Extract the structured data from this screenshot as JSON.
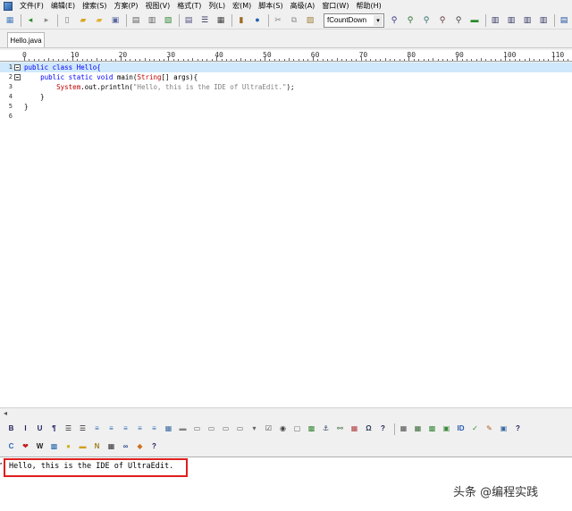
{
  "menu": [
    "文件(F)",
    "编辑(E)",
    "搜索(S)",
    "方案(P)",
    "视图(V)",
    "格式(T)",
    "列(L)",
    "宏(M)",
    "脚本(S)",
    "高级(A)",
    "窗口(W)",
    "帮助(H)"
  ],
  "toolbar": {
    "function_list_value": "fCountDown",
    "icons": [
      {
        "name": "new-file-icon",
        "glyph": "▦",
        "color": "#4a7fc0"
      },
      {
        "name": "back-icon",
        "glyph": "◂",
        "color": "#2a8a2a"
      },
      {
        "name": "forward-icon",
        "glyph": "▸",
        "color": "#8a8a8a"
      },
      {
        "name": "blank-doc-icon",
        "glyph": "▯",
        "color": "#7a7a7a"
      },
      {
        "name": "open-folder-icon",
        "glyph": "▰",
        "color": "#d9a520"
      },
      {
        "name": "open-project-icon",
        "glyph": "▰",
        "color": "#e0b030"
      },
      {
        "name": "save-icon",
        "glyph": "▣",
        "color": "#5a6aa0"
      },
      {
        "name": "print-icon",
        "glyph": "▤",
        "color": "#606060"
      },
      {
        "name": "print-preview-icon",
        "glyph": "▥",
        "color": "#606060"
      },
      {
        "name": "export-icon",
        "glyph": "▧",
        "color": "#3a8a3a"
      },
      {
        "name": "document-icon",
        "glyph": "▤",
        "color": "#505080"
      },
      {
        "name": "list-icon",
        "glyph": "☰",
        "color": "#303060"
      },
      {
        "name": "hex-icon",
        "glyph": "▦",
        "color": "#404040"
      },
      {
        "name": "book-icon",
        "glyph": "▮",
        "color": "#a06a20"
      },
      {
        "name": "globe-icon",
        "glyph": "●",
        "color": "#2060b0"
      },
      {
        "name": "cut-icon",
        "glyph": "✂",
        "color": "#808080"
      },
      {
        "name": "copy-icon",
        "glyph": "⧉",
        "color": "#909090"
      },
      {
        "name": "paste-icon",
        "glyph": "▨",
        "color": "#a08040"
      }
    ],
    "right_icons": [
      {
        "name": "find-icon",
        "glyph": "⚲",
        "color": "#303080"
      },
      {
        "name": "find-next-icon",
        "glyph": "⚲",
        "color": "#2a6a2a"
      },
      {
        "name": "replace-icon",
        "glyph": "⚲",
        "color": "#2a6a6a"
      },
      {
        "name": "find-in-files-icon",
        "glyph": "⚲",
        "color": "#603030"
      },
      {
        "name": "replace-in-files-icon",
        "glyph": "⚲",
        "color": "#404040"
      },
      {
        "name": "goto-icon",
        "glyph": "▬",
        "color": "#2a8a2a"
      },
      {
        "name": "align-left-icon",
        "glyph": "▥",
        "color": "#303060"
      },
      {
        "name": "align-center-icon",
        "glyph": "▥",
        "color": "#303060"
      },
      {
        "name": "align-right-icon",
        "glyph": "▥",
        "color": "#303060"
      },
      {
        "name": "justify-icon",
        "glyph": "▥",
        "color": "#303060"
      },
      {
        "name": "split-h-icon",
        "glyph": "▤",
        "color": "#1f4fa0"
      },
      {
        "name": "split-v-icon",
        "glyph": "▥",
        "color": "#1f4fa0"
      },
      {
        "name": "tile-icon",
        "glyph": "▧",
        "color": "#1f4fa0"
      },
      {
        "name": "window-icon",
        "glyph": "▢",
        "color": "#404040"
      },
      {
        "name": "web-icon",
        "glyph": "●",
        "color": "#2a7ac0"
      },
      {
        "name": "help-icon",
        "glyph": "?",
        "color": "#2050a0"
      }
    ]
  },
  "tab": {
    "filename": "Hello.java"
  },
  "ruler": [
    "0",
    "10",
    "20",
    "30",
    "40",
    "50",
    "60",
    "70",
    "80",
    "90",
    "100",
    "110"
  ],
  "code_lines": [
    {
      "num": "1",
      "fold": true,
      "current": true,
      "tokens": [
        [
          "kw",
          "public class Hello{"
        ]
      ]
    },
    {
      "num": "2",
      "fold": true,
      "current": false,
      "tokens": [
        [
          "tx",
          "    "
        ],
        [
          "kw",
          "public static void"
        ],
        [
          "tx",
          " main("
        ],
        [
          "ty",
          "String"
        ],
        [
          "tx",
          "[] args){"
        ]
      ]
    },
    {
      "num": "3",
      "fold": false,
      "current": false,
      "tokens": [
        [
          "tx",
          "        "
        ],
        [
          "sy",
          "System"
        ],
        [
          "tx",
          ".out.println("
        ],
        [
          "st",
          "\"Hello, this is the IDE of UltraEdit.\""
        ],
        [
          "tx",
          ");"
        ]
      ]
    },
    {
      "num": "4",
      "fold": false,
      "current": false,
      "tokens": [
        [
          "tx",
          "    }"
        ]
      ]
    },
    {
      "num": "5",
      "fold": false,
      "current": false,
      "tokens": [
        [
          "tx",
          "}"
        ]
      ]
    },
    {
      "num": "6",
      "fold": false,
      "current": false,
      "tokens": [
        [
          "tx",
          ""
        ]
      ]
    }
  ],
  "html_toolbar1": [
    {
      "name": "bold-icon",
      "glyph": "B",
      "color": "#202060"
    },
    {
      "name": "italic-icon",
      "glyph": "I",
      "color": "#202060"
    },
    {
      "name": "underline-icon",
      "glyph": "U",
      "color": "#202060"
    },
    {
      "name": "paragraph-icon",
      "glyph": "¶",
      "color": "#202060"
    },
    {
      "name": "bullet-list-icon",
      "glyph": "☰",
      "color": "#202020"
    },
    {
      "name": "number-list-icon",
      "glyph": "☰",
      "color": "#202020"
    },
    {
      "name": "align-left-html-icon",
      "glyph": "≡",
      "color": "#2a6ab0"
    },
    {
      "name": "align-center-html-icon",
      "glyph": "≡",
      "color": "#2a6ab0"
    },
    {
      "name": "indent-icon",
      "glyph": "≡",
      "color": "#2a6ab0"
    },
    {
      "name": "outdent-icon",
      "glyph": "≡",
      "color": "#2a6ab0"
    },
    {
      "name": "blockquote-icon",
      "glyph": "≡",
      "color": "#2a6ab0"
    },
    {
      "name": "table-icon",
      "glyph": "▦",
      "color": "#3a6aa0"
    },
    {
      "name": "hr-icon",
      "glyph": "▬",
      "color": "#808080"
    },
    {
      "name": "form-icon",
      "glyph": "▭",
      "color": "#606060"
    },
    {
      "name": "button-icon",
      "glyph": "▭",
      "color": "#606060"
    },
    {
      "name": "input-icon",
      "glyph": "▭",
      "color": "#606060"
    },
    {
      "name": "textarea-icon",
      "glyph": "▭",
      "color": "#606060"
    },
    {
      "name": "select-icon",
      "glyph": "▾",
      "color": "#606060"
    },
    {
      "name": "checkbox-icon",
      "glyph": "☑",
      "color": "#404040"
    },
    {
      "name": "radio-icon",
      "glyph": "◉",
      "color": "#404040"
    },
    {
      "name": "frame-icon",
      "glyph": "▢",
      "color": "#606060"
    },
    {
      "name": "image-icon",
      "glyph": "▩",
      "color": "#3a8a3a"
    },
    {
      "name": "anchor-icon",
      "glyph": "⚓",
      "color": "#304060"
    },
    {
      "name": "link-icon",
      "glyph": "⚯",
      "color": "#306030"
    },
    {
      "name": "color-icon",
      "glyph": "▦",
      "color": "#b04040"
    },
    {
      "name": "special-char-icon",
      "glyph": "Ω",
      "color": "#304060"
    },
    {
      "name": "html-help-icon",
      "glyph": "?",
      "color": "#202060"
    },
    {
      "name": "grid-icon",
      "glyph": "▦",
      "color": "#505050"
    },
    {
      "name": "view-icon",
      "glyph": "▦",
      "color": "#3a6a3a"
    },
    {
      "name": "css-icon",
      "glyph": "▩",
      "color": "#3a8a3a"
    },
    {
      "name": "validate-icon",
      "glyph": "▣",
      "color": "#3a8a3a"
    },
    {
      "name": "id-icon",
      "glyph": "ID",
      "color": "#2a5ab0"
    },
    {
      "name": "spell-icon",
      "glyph": "✓",
      "color": "#2a8a2a"
    },
    {
      "name": "tools-icon",
      "glyph": "✎",
      "color": "#b06020"
    },
    {
      "name": "preview-icon",
      "glyph": "▣",
      "color": "#3a6aa0"
    },
    {
      "name": "html-help2-icon",
      "glyph": "?",
      "color": "#202060"
    }
  ],
  "html_toolbar2": [
    {
      "name": "refresh-icon",
      "glyph": "C",
      "color": "#2a6ab0"
    },
    {
      "name": "heart-icon",
      "glyph": "❤",
      "color": "#c02020"
    },
    {
      "name": "wiki-icon",
      "glyph": "W",
      "color": "#202020"
    },
    {
      "name": "box-icon",
      "glyph": "▩",
      "color": "#2a6ab0"
    },
    {
      "name": "bulb-icon",
      "glyph": "●",
      "color": "#d0b020"
    },
    {
      "name": "note-icon",
      "glyph": "▬",
      "color": "#d0a020"
    },
    {
      "name": "n-icon",
      "glyph": "N",
      "color": "#a08020"
    },
    {
      "name": "code-icon",
      "glyph": "▦",
      "color": "#303030"
    },
    {
      "name": "chain-icon",
      "glyph": "∞",
      "color": "#305090"
    },
    {
      "name": "windows-icon",
      "glyph": "◆",
      "color": "#d07020"
    },
    {
      "name": "about-icon",
      "glyph": "?",
      "color": "#202060"
    }
  ],
  "output": {
    "text": "Hello, this is the IDE of UltraEdit."
  },
  "watermark": "头条 @编程实践"
}
